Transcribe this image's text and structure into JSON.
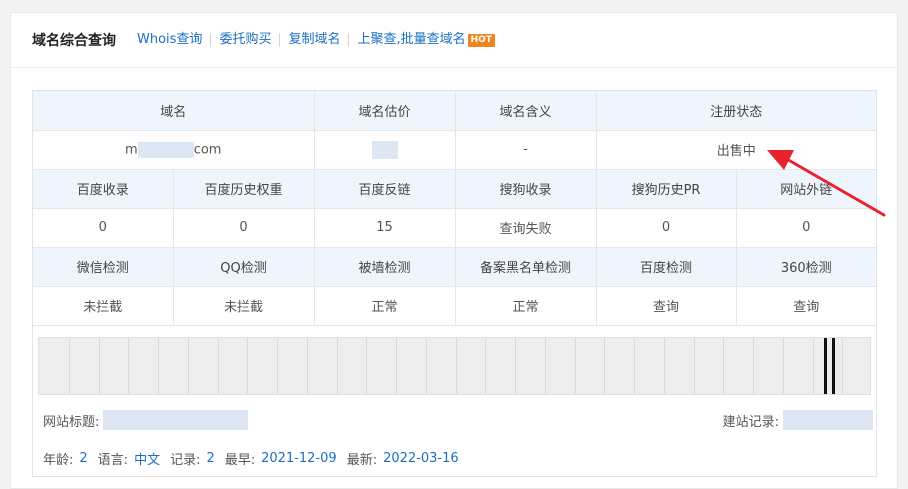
{
  "header": {
    "title": "域名综合查询",
    "links": [
      "Whois查询",
      "委托购买",
      "复制域名",
      "上聚查,批量查域名"
    ],
    "hot_badge": "HOT"
  },
  "table": {
    "row1_headers": [
      "域名",
      "域名估价",
      "域名含义",
      "注册状态"
    ],
    "row1_values": {
      "domain_prefix": "m",
      "domain_suffix": "com",
      "meaning": "-",
      "status": "出售中"
    },
    "row2_headers": [
      "百度收录",
      "百度历史权重",
      "百度反链",
      "搜狗收录",
      "搜狗历史PR",
      "网站外链"
    ],
    "row2_values": [
      "0",
      "0",
      "15",
      "查询失败",
      "0",
      "0"
    ],
    "row3_headers": [
      "微信检测",
      "QQ检测",
      "被墙检测",
      "备案黑名单检测",
      "百度检测",
      "360检测"
    ],
    "row3_values": [
      "未拦截",
      "未拦截",
      "正常",
      "正常",
      "查询",
      "查询"
    ]
  },
  "site": {
    "title_label": "网站标题:",
    "record_label": "建站记录:"
  },
  "meta": {
    "age_label": "年龄:",
    "age": "2",
    "lang_label": "语言:",
    "lang": "中文",
    "records_label": "记录:",
    "records": "2",
    "earliest_label": "最早:",
    "earliest": "2021-12-09",
    "latest_label": "最新:",
    "latest": "2022-03-16"
  },
  "colors": {
    "link": "#1a6fc4",
    "ok": "#1e8c1e",
    "header_bg": "#eef5fc",
    "arrow": "#e8232d",
    "hot": "#f0841e"
  }
}
